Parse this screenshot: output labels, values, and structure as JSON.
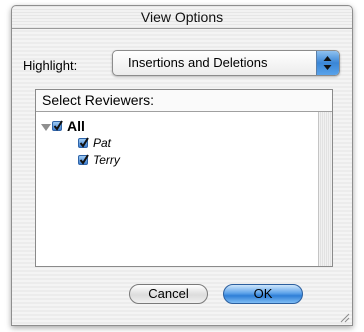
{
  "window": {
    "title": "View Options"
  },
  "highlight": {
    "label": "Highlight:",
    "value": "Insertions and Deletions"
  },
  "reviewers": {
    "header": "Select Reviewers:",
    "root": {
      "label": "All",
      "checked": true,
      "expanded": true
    },
    "items": [
      {
        "label": "Pat",
        "checked": true
      },
      {
        "label": "Terry",
        "checked": true
      }
    ]
  },
  "buttons": {
    "cancel": "Cancel",
    "ok": "OK"
  },
  "colors": {
    "accent": "#3a86d6",
    "window_bg": "#ececec"
  }
}
